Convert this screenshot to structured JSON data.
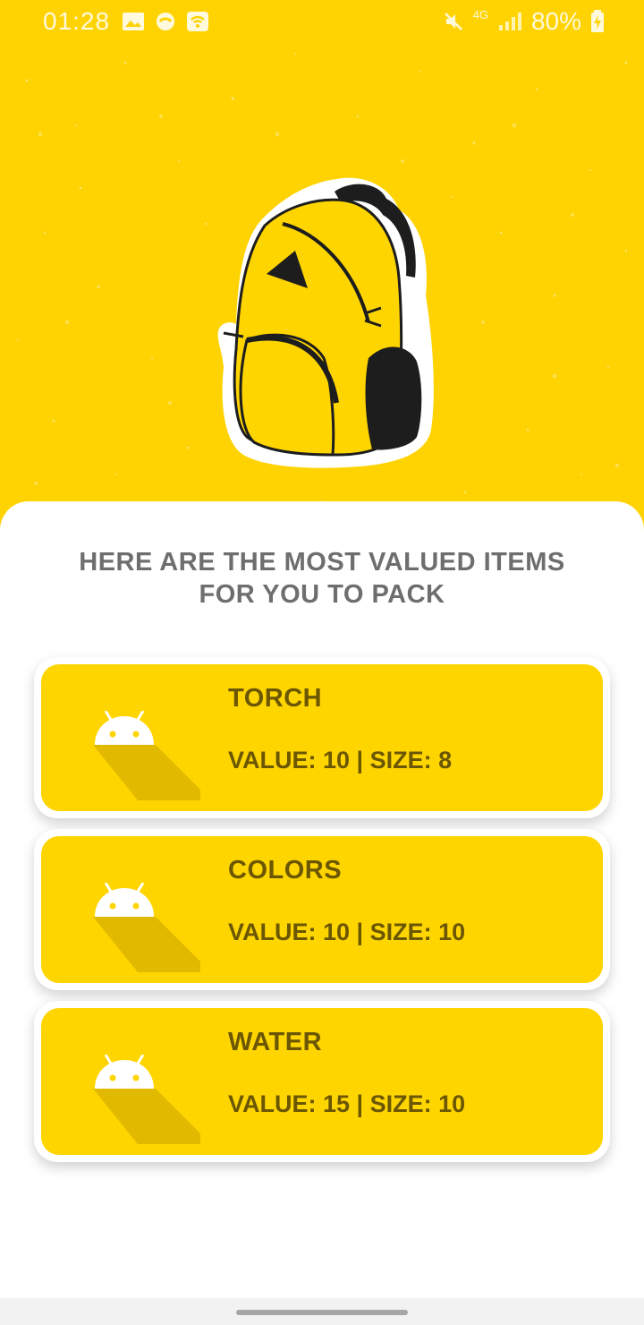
{
  "status_bar": {
    "time": "01:28",
    "battery": "80%",
    "network": "4G",
    "icons_left": [
      "gallery-icon",
      "photos-icon",
      "wifi-icon"
    ],
    "icons_right": [
      "mute-icon",
      "signal-icon",
      "battery-charging-icon"
    ]
  },
  "hero": {
    "image": "backpack-illustration",
    "background_color": "#ffd302"
  },
  "heading": {
    "line1": "HERE ARE THE MOST VALUED ITEMS",
    "line2": "FOR YOU TO PACK"
  },
  "items": [
    {
      "name": "TORCH",
      "value_label": "VALUE: 10 | SIZE: 8",
      "icon": "android-icon"
    },
    {
      "name": "COLORS",
      "value_label": "VALUE: 10 | SIZE: 10",
      "icon": "android-icon"
    },
    {
      "name": "WATER",
      "value_label": "VALUE: 15 | SIZE: 10",
      "icon": "android-icon"
    }
  ],
  "colors": {
    "accent": "#ffd500",
    "card_text": "#6b5602",
    "heading_text": "#6e6e6e"
  }
}
